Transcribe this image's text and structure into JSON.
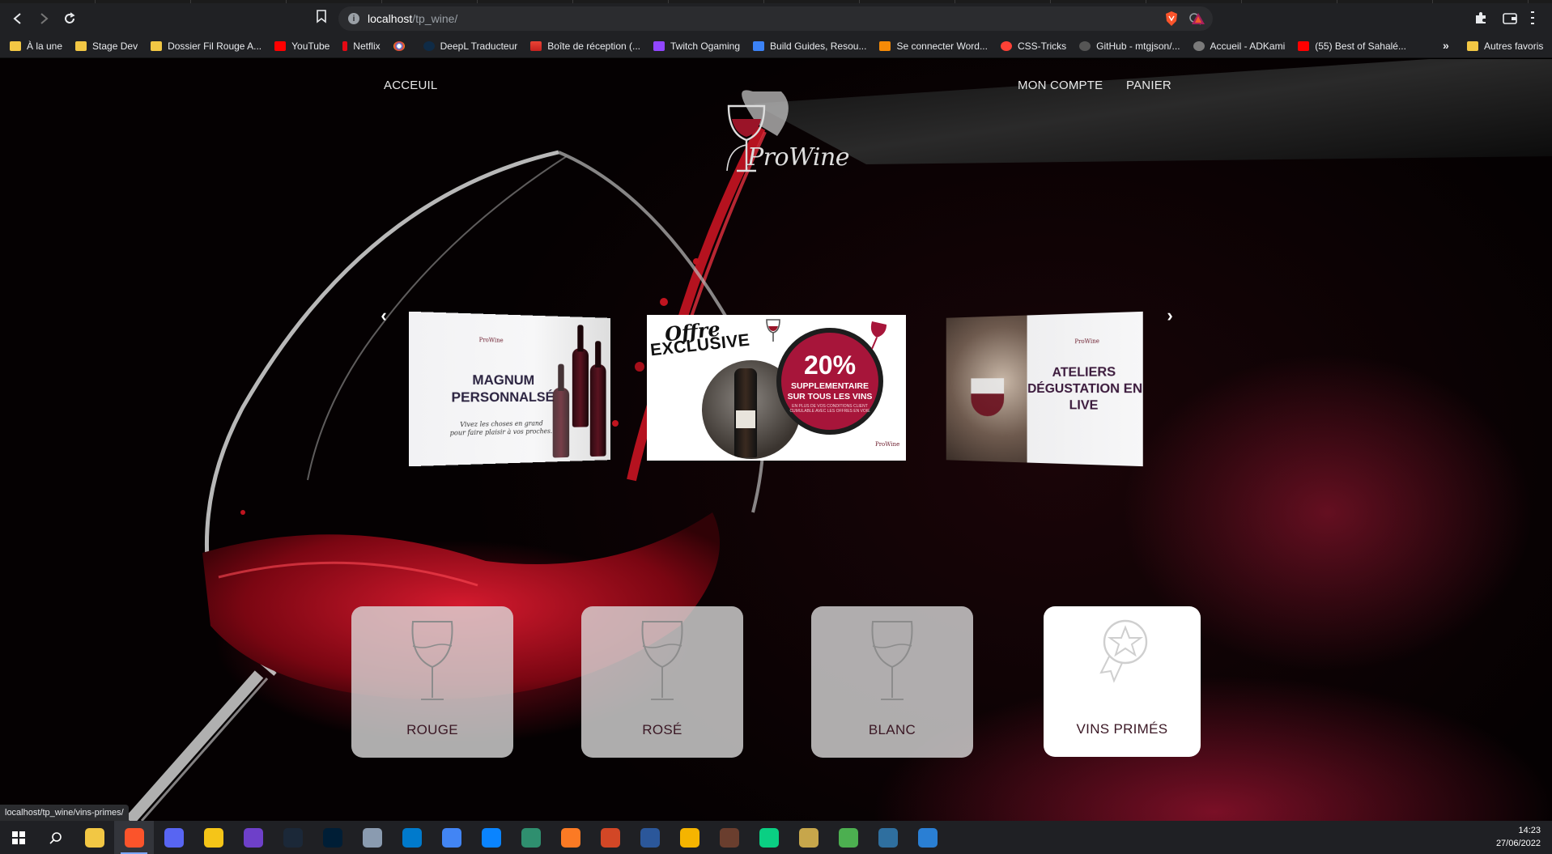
{
  "browser": {
    "url_host": "localhost",
    "url_path": "/tp_wine/",
    "status_url": "localhost/tp_wine/vins-primes/",
    "bookmarks": [
      {
        "label": "À la une",
        "icon": "folder-icon"
      },
      {
        "label": "Stage Dev",
        "icon": "folder-icon"
      },
      {
        "label": "Dossier Fil Rouge A...",
        "icon": "folder-icon"
      },
      {
        "label": "YouTube",
        "icon": "youtube-icon"
      },
      {
        "label": "Netflix",
        "icon": "netflix-icon"
      },
      {
        "label": "",
        "icon": "google-icon"
      },
      {
        "label": "DeepL Traducteur",
        "icon": "deepl-icon"
      },
      {
        "label": "Boîte de réception (...",
        "icon": "gmail-icon"
      },
      {
        "label": "Twitch Ogaming",
        "icon": "twitch-icon"
      },
      {
        "label": "Build Guides, Resou...",
        "icon": "build-guides-icon"
      },
      {
        "label": "Se connecter Word...",
        "icon": "wordpress-icon"
      },
      {
        "label": "CSS-Tricks",
        "icon": "css-tricks-icon"
      },
      {
        "label": "GitHub - mtgjson/...",
        "icon": "github-icon"
      },
      {
        "label": "Accueil - ADKami",
        "icon": "adkami-icon"
      },
      {
        "label": "(55) Best of Sahalé...",
        "icon": "youtube-icon"
      }
    ],
    "bookmarks_more": "»",
    "other_bookmarks": "Autres favoris"
  },
  "nav": {
    "home": "ACCEUIL",
    "account": "MON COMPTE",
    "cart": "PANIER"
  },
  "logo": {
    "text": "ProWine"
  },
  "carousel": {
    "prev": "‹",
    "next": "›",
    "slides": {
      "left": {
        "title_line1": "MAGNUM",
        "title_line2": "PERSONNALSÉ",
        "subtitle_line1": "Vivez les choses en grand",
        "subtitle_line2": "pour faire plaisir à vos proches.",
        "mini_logo": "ProWine"
      },
      "center": {
        "offre_line1": "Offre",
        "offre_line2": "EXCLUSIVE",
        "percent": "20%",
        "line1": "SUPPLEMENTAIRE",
        "line2": "SUR TOUS LES VINS",
        "fine_print": "EN PLUS DE VOS CONDITIONS CLIENT CUMULABLE AVEC LES OFFRES EN VOIE",
        "mini_logo": "ProWine"
      },
      "right": {
        "title_line1": "ATELIERS",
        "title_line2": "DÉGUSTATION EN",
        "title_line3": "LIVE",
        "mini_logo": "ProWine"
      }
    }
  },
  "categories": [
    {
      "label": "ROUGE",
      "icon": "wine-glass-icon"
    },
    {
      "label": "ROSÉ",
      "icon": "wine-glass-icon"
    },
    {
      "label": "BLANC",
      "icon": "wine-glass-icon"
    },
    {
      "label": "VINS PRIMÉS",
      "icon": "award-medal-icon"
    }
  ],
  "taskbar": {
    "time": "14:23",
    "date": "27/06/2022",
    "apps": [
      {
        "name": "file-explorer",
        "color": "#f2c744"
      },
      {
        "name": "brave-browser",
        "color": "#fb542b",
        "active": true
      },
      {
        "name": "discord",
        "color": "#5865f2"
      },
      {
        "name": "chat-app",
        "color": "#f5c518"
      },
      {
        "name": "github-desktop",
        "color": "#6e40c9"
      },
      {
        "name": "steam",
        "color": "#1b2838"
      },
      {
        "name": "photoshop",
        "color": "#001e36"
      },
      {
        "name": "cloud-app",
        "color": "#8a9bb0"
      },
      {
        "name": "vscode",
        "color": "#007acc"
      },
      {
        "name": "chrome",
        "color": "#4285f4"
      },
      {
        "name": "bluetooth-app",
        "color": "#0a84ff"
      },
      {
        "name": "git-client",
        "color": "#2f8f6f"
      },
      {
        "name": "xampp",
        "color": "#fb7a24"
      },
      {
        "name": "powerpoint",
        "color": "#d24726"
      },
      {
        "name": "word",
        "color": "#2b579a"
      },
      {
        "name": "star-app",
        "color": "#f5b400"
      },
      {
        "name": "game-app",
        "color": "#6a3e2e"
      },
      {
        "name": "figma-app",
        "color": "#0acf83"
      },
      {
        "name": "notes-app",
        "color": "#c7a64b"
      },
      {
        "name": "tiles-app",
        "color": "#4caf50"
      },
      {
        "name": "mysql-workbench",
        "color": "#2f6f9f"
      },
      {
        "name": "photos-app",
        "color": "#2a7fd4"
      }
    ]
  },
  "colors": {
    "accent_wine": "#a7153a",
    "card_text": "#3a1724",
    "background": "#050102"
  }
}
